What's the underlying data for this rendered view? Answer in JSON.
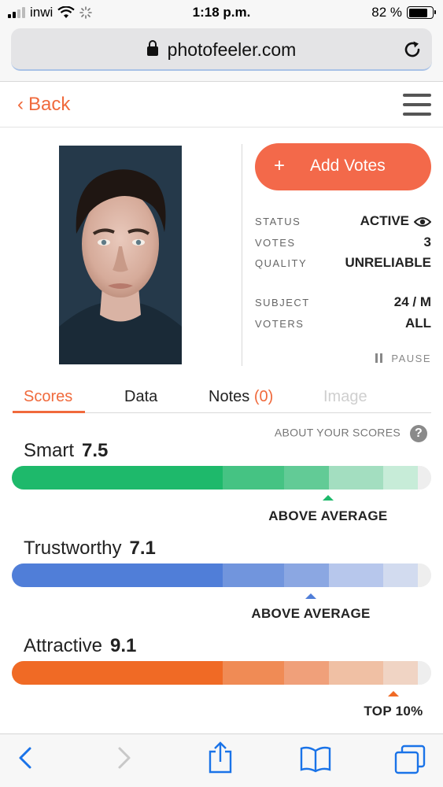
{
  "status_bar": {
    "carrier": "inwi",
    "time": "1:18 p.m.",
    "battery": "82 %"
  },
  "browser": {
    "url": "photofeeler.com"
  },
  "nav": {
    "back_label": "Back"
  },
  "photo": {
    "alt": "Portrait of a young man with dark hair"
  },
  "actions": {
    "add_votes_symbol": "+",
    "add_votes_label": "Add Votes",
    "pause_label": "PAUSE"
  },
  "info": [
    {
      "key": "STATUS",
      "value": "ACTIVE"
    },
    {
      "key": "VOTES",
      "value": "3"
    },
    {
      "key": "QUALITY",
      "value": "UNRELIABLE"
    },
    {
      "key": "SUBJECT",
      "value": "24 / M"
    },
    {
      "key": "VOTERS",
      "value": "ALL"
    }
  ],
  "tabs": {
    "scores": "Scores",
    "data": "Data",
    "notes": "Notes",
    "notes_count": "(0)",
    "image": "Image"
  },
  "about_scores": {
    "label": "ABOUT YOUR SCORES",
    "icon_symbol": "?"
  },
  "scores": [
    {
      "name": "Smart",
      "value": "7.5",
      "level": "ABOVE AVERAGE",
      "fraction": 0.754,
      "colors": [
        "#1eb96b",
        "#45c383",
        "#62cb96",
        "#a3dec0",
        "#c7ecd8",
        "#eeeeee"
      ]
    },
    {
      "name": "Trustworthy",
      "value": "7.1",
      "level": "ABOVE AVERAGE",
      "fraction": 0.713,
      "colors": [
        "#507ed8",
        "#7195dd",
        "#8ba7e2",
        "#b7c7ec",
        "#d2dbef",
        "#eeeeee"
      ]
    },
    {
      "name": "Attractive",
      "value": "9.1",
      "level": "TOP 10%",
      "fraction": 0.91,
      "colors": [
        "#f06a25",
        "#f08b55",
        "#f0a07a",
        "#f0c0a4",
        "#f0d4c4",
        "#eeeeee"
      ]
    }
  ]
}
